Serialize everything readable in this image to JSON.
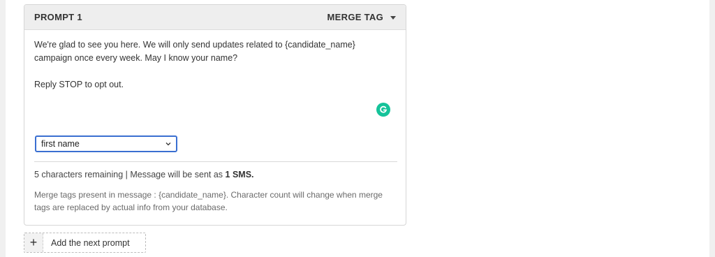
{
  "prompt_card": {
    "title": "PROMPT 1",
    "merge_tag_label": "MERGE TAG",
    "message": "We're glad to see you here. We will only send updates related to {candidate_name}\ncampaign once every week. May I know your name?\n\nReply STOP to opt out.",
    "merge_tag_select": {
      "selected": "first name"
    },
    "char_count_text": "5 characters remaining | Message will be sent as ",
    "sms_count": "1 SMS.",
    "merge_note": "Merge tags present in message : {candidate_name}. Character count will change when merge tags are replaced by actual info from your database."
  },
  "add_prompt": {
    "plus_icon": "+",
    "label": "Add the next prompt"
  },
  "colors": {
    "grammarly_green": "#15c39a",
    "select_border": "#3a6fd1",
    "header_bg": "#eeeeee"
  },
  "icons": {
    "merge_tag_caret": "caret-down-icon",
    "grammarly": "grammarly-icon",
    "select_chevron": "chevron-down-icon",
    "add": "plus-icon"
  }
}
